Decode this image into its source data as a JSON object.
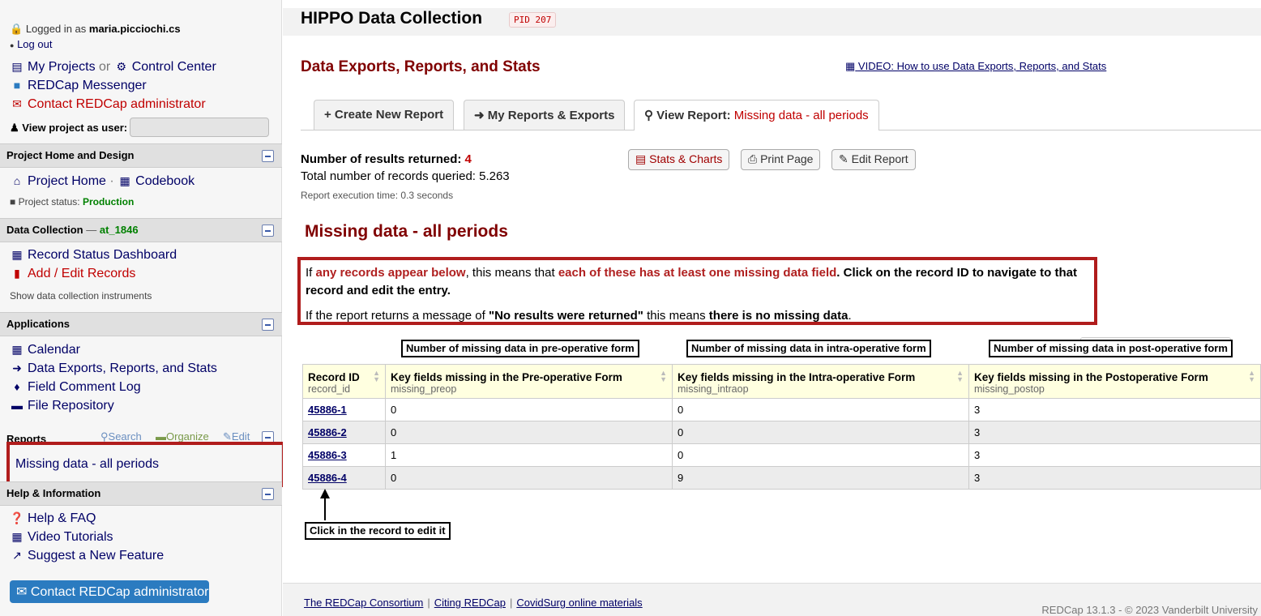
{
  "sidebar": {
    "logged_in_prefix": "Logged in as",
    "username": "maria.picciochi.cs",
    "logout": "Log out",
    "my_projects": "My Projects",
    "or": "or",
    "control_center": "Control Center",
    "messenger": "REDCap Messenger",
    "contact_admin": "Contact REDCap administrator",
    "view_as_user": "View project as user:",
    "sections": {
      "home_design": {
        "title": "Project Home and Design",
        "project_home": "Project Home",
        "sep": "·",
        "codebook": "Codebook",
        "status_label": "Project status:",
        "status_value": "Production"
      },
      "data_collection": {
        "title": "Data Collection",
        "dash": "—",
        "arm": "at_1846",
        "record_status": "Record Status Dashboard",
        "add_edit": "Add / Edit Records",
        "show_instruments": "Show data collection instruments"
      },
      "applications": {
        "title": "Applications",
        "items": [
          "Calendar",
          "Data Exports, Reports, and Stats",
          "Field Comment Log",
          "File Repository"
        ]
      },
      "reports": {
        "title": "Reports",
        "search": "Search",
        "organize": "Organize",
        "edit": "Edit",
        "items": [
          "Missing data - all periods"
        ]
      },
      "help": {
        "title": "Help & Information",
        "items": [
          "Help & FAQ",
          "Video Tutorials",
          "Suggest a New Feature"
        ]
      }
    },
    "contact_button": "Contact REDCap administrator"
  },
  "header": {
    "app_title": "HIPPO Data Collection",
    "pid": "PID 207",
    "page_title": "Data Exports, Reports, and Stats",
    "video_link": "VIDEO: How to use Data Exports, Reports, and Stats"
  },
  "tabs": {
    "create": "+ Create New Report",
    "my_reports": "My Reports & Exports",
    "view_prefix": "View Report:",
    "view_name": "Missing data - all periods"
  },
  "results": {
    "label": "Number of results returned:",
    "count": "4",
    "total": "Total number of records queried: 5.263",
    "exec_time": "Report execution time: 0.3 seconds"
  },
  "buttons": {
    "stats": "Stats & Charts",
    "print": "Print Page",
    "edit": "Edit Report"
  },
  "report_title": "Missing data - all periods",
  "info": {
    "p1_a": "If ",
    "p1_b": "any records appear below",
    "p1_c": ", this means that ",
    "p1_d": "each of these has at least one missing data field",
    "p1_e": ". Click on the record ID to navigate to that record and edit the entry.",
    "p2_a": "If the report returns a message of ",
    "p2_b": "\"No results were returned\"",
    "p2_c": " this means ",
    "p2_d": "there is no missing data",
    "p2_e": "."
  },
  "callouts": {
    "preop": "Number of missing data in pre-operative form",
    "intraop": "Number of missing data in intra-operative form",
    "postop": "Number of missing data in post-operative form",
    "click": "Click in the record to edit it"
  },
  "table": {
    "columns": [
      {
        "label": "Record ID",
        "var": "record_id"
      },
      {
        "label": "Key fields missing in the Pre-operative Form",
        "var": "missing_preop"
      },
      {
        "label": "Key fields missing in the Intra-operative Form",
        "var": "missing_intraop"
      },
      {
        "label": "Key fields missing in the Postoperative Form",
        "var": "missing_postop"
      }
    ],
    "rows": [
      [
        "45886-1",
        "0",
        "0",
        "3"
      ],
      [
        "45886-2",
        "0",
        "0",
        "3"
      ],
      [
        "45886-3",
        "1",
        "0",
        "3"
      ],
      [
        "45886-4",
        "0",
        "9",
        "3"
      ]
    ]
  },
  "footer": {
    "links": [
      "The REDCap Consortium",
      "Citing REDCap",
      "CovidSurg online materials"
    ],
    "separator": "|",
    "version": "REDCap 13.1.3 - © 2023 Vanderbilt University"
  },
  "colors": {
    "accent_red": "#800000",
    "link_blue": "#000066",
    "callout_border_red": "#b01c1c",
    "table_header": "#ffffe0",
    "contact_button": "#2b7bc0"
  }
}
